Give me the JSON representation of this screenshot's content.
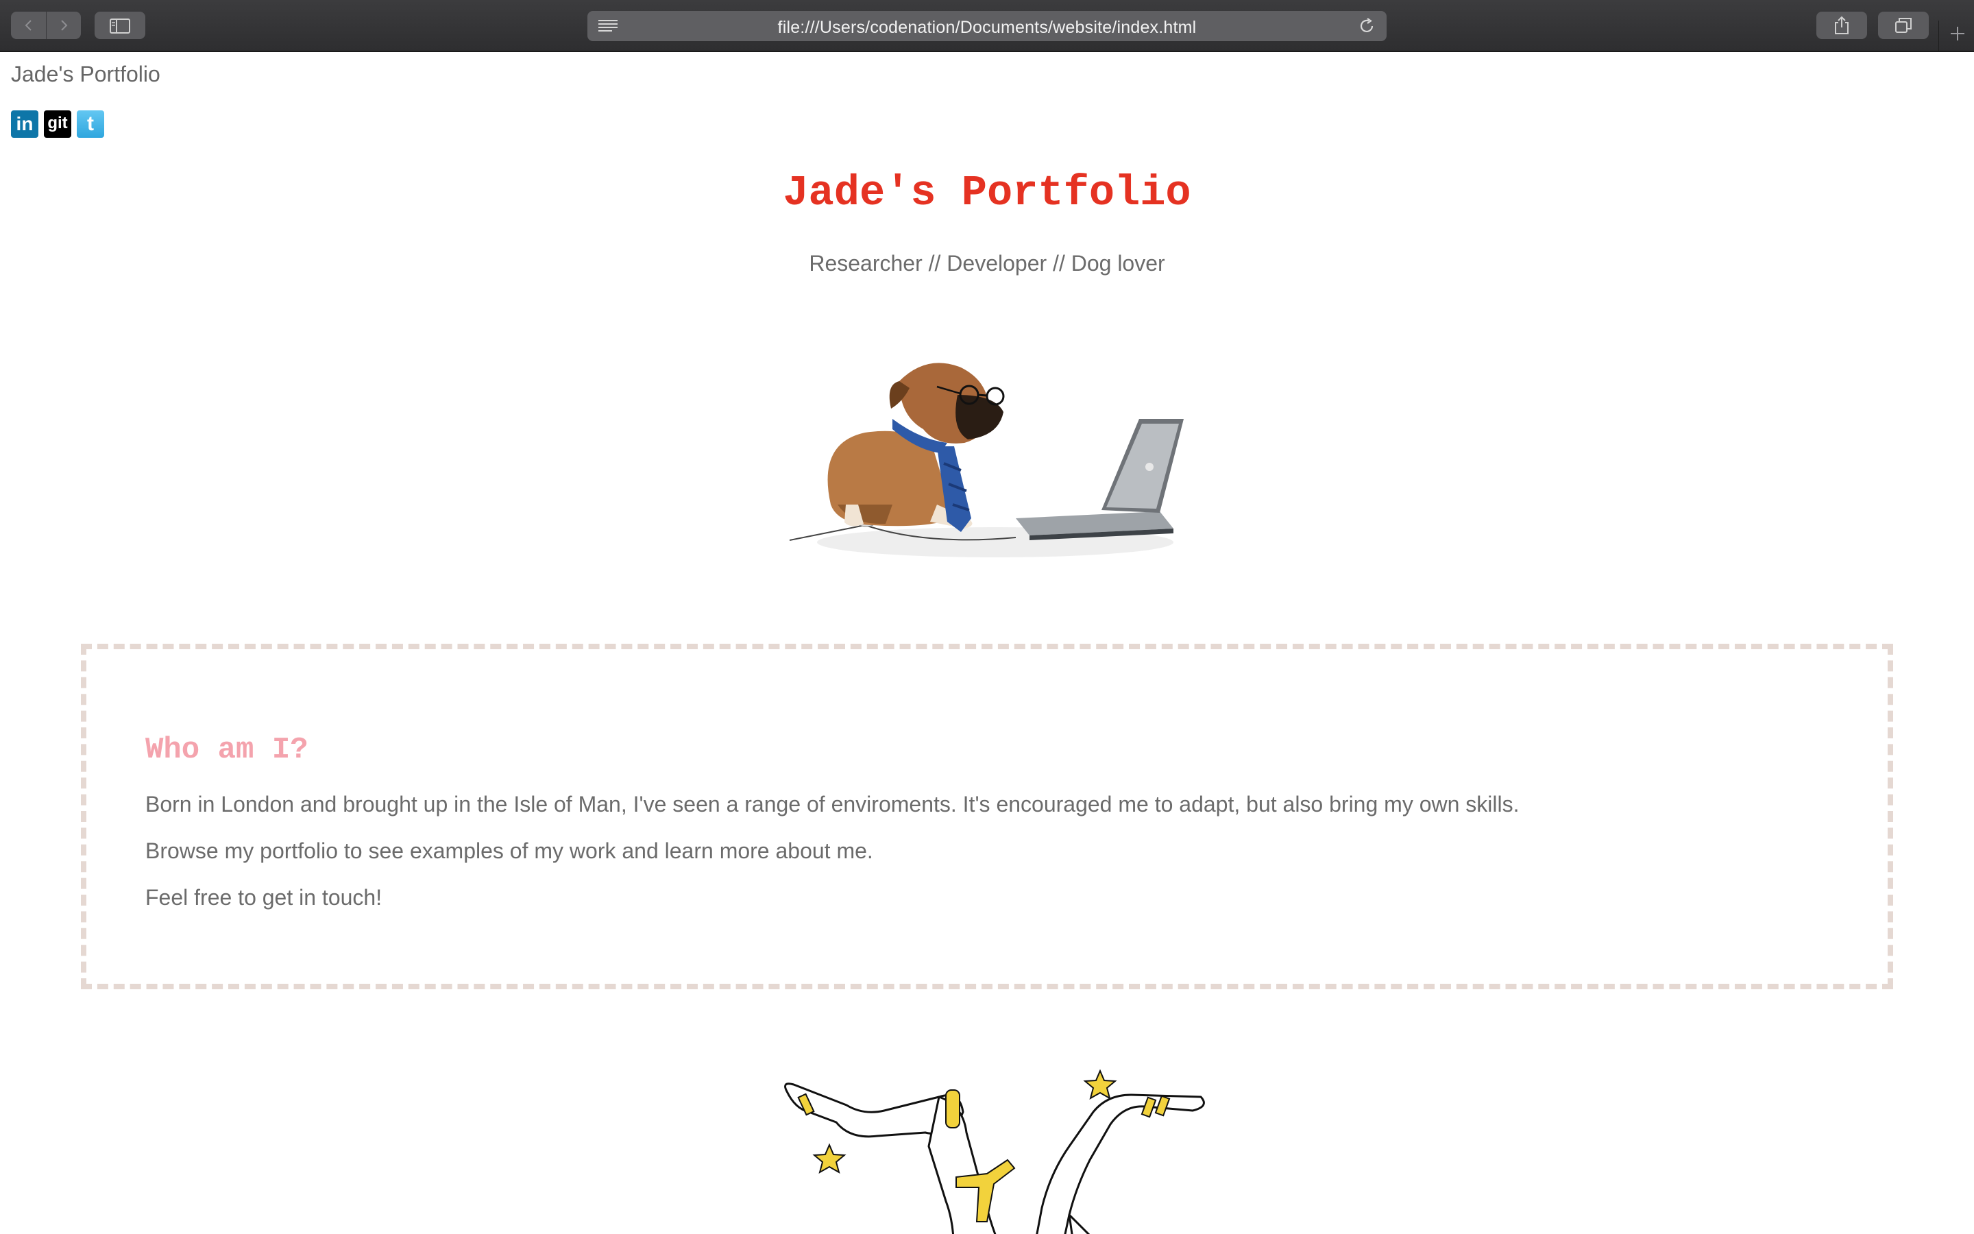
{
  "browser": {
    "url": "file:///Users/codenation/Documents/website/index.html",
    "icons": {
      "back": "chevron-left-icon",
      "forward": "chevron-right-icon",
      "sidebar": "sidebar-icon",
      "reader": "reader-lines-icon",
      "reload": "reload-icon",
      "share": "share-icon",
      "tabs": "tabs-overview-icon",
      "new_tab": "plus-icon"
    }
  },
  "page": {
    "nav_title": "Jade's Portfolio",
    "socials": [
      {
        "name": "LinkedIn",
        "text": "in",
        "color": "#0e76a8"
      },
      {
        "name": "GitHub",
        "text": "git",
        "color": "#000000"
      },
      {
        "name": "Twitter",
        "text": "t",
        "color": "#2fa6de"
      }
    ],
    "hero": {
      "title": "Jade's Portfolio",
      "subtitle": "Researcher // Developer // Dog lover",
      "title_color": "#e53222"
    },
    "about": {
      "heading": "Who am I?",
      "heading_color": "#f4a3ad",
      "border_color": "#e5d8d2",
      "paragraphs": [
        "Born in London and brought up in the Isle of Man, I've seen a range of enviroments. It's encouraged me to adapt, but also bring my own skills.",
        "Browse my portfolio to see examples of my work and learn more about me.",
        "Feel free to get in touch!"
      ]
    }
  }
}
